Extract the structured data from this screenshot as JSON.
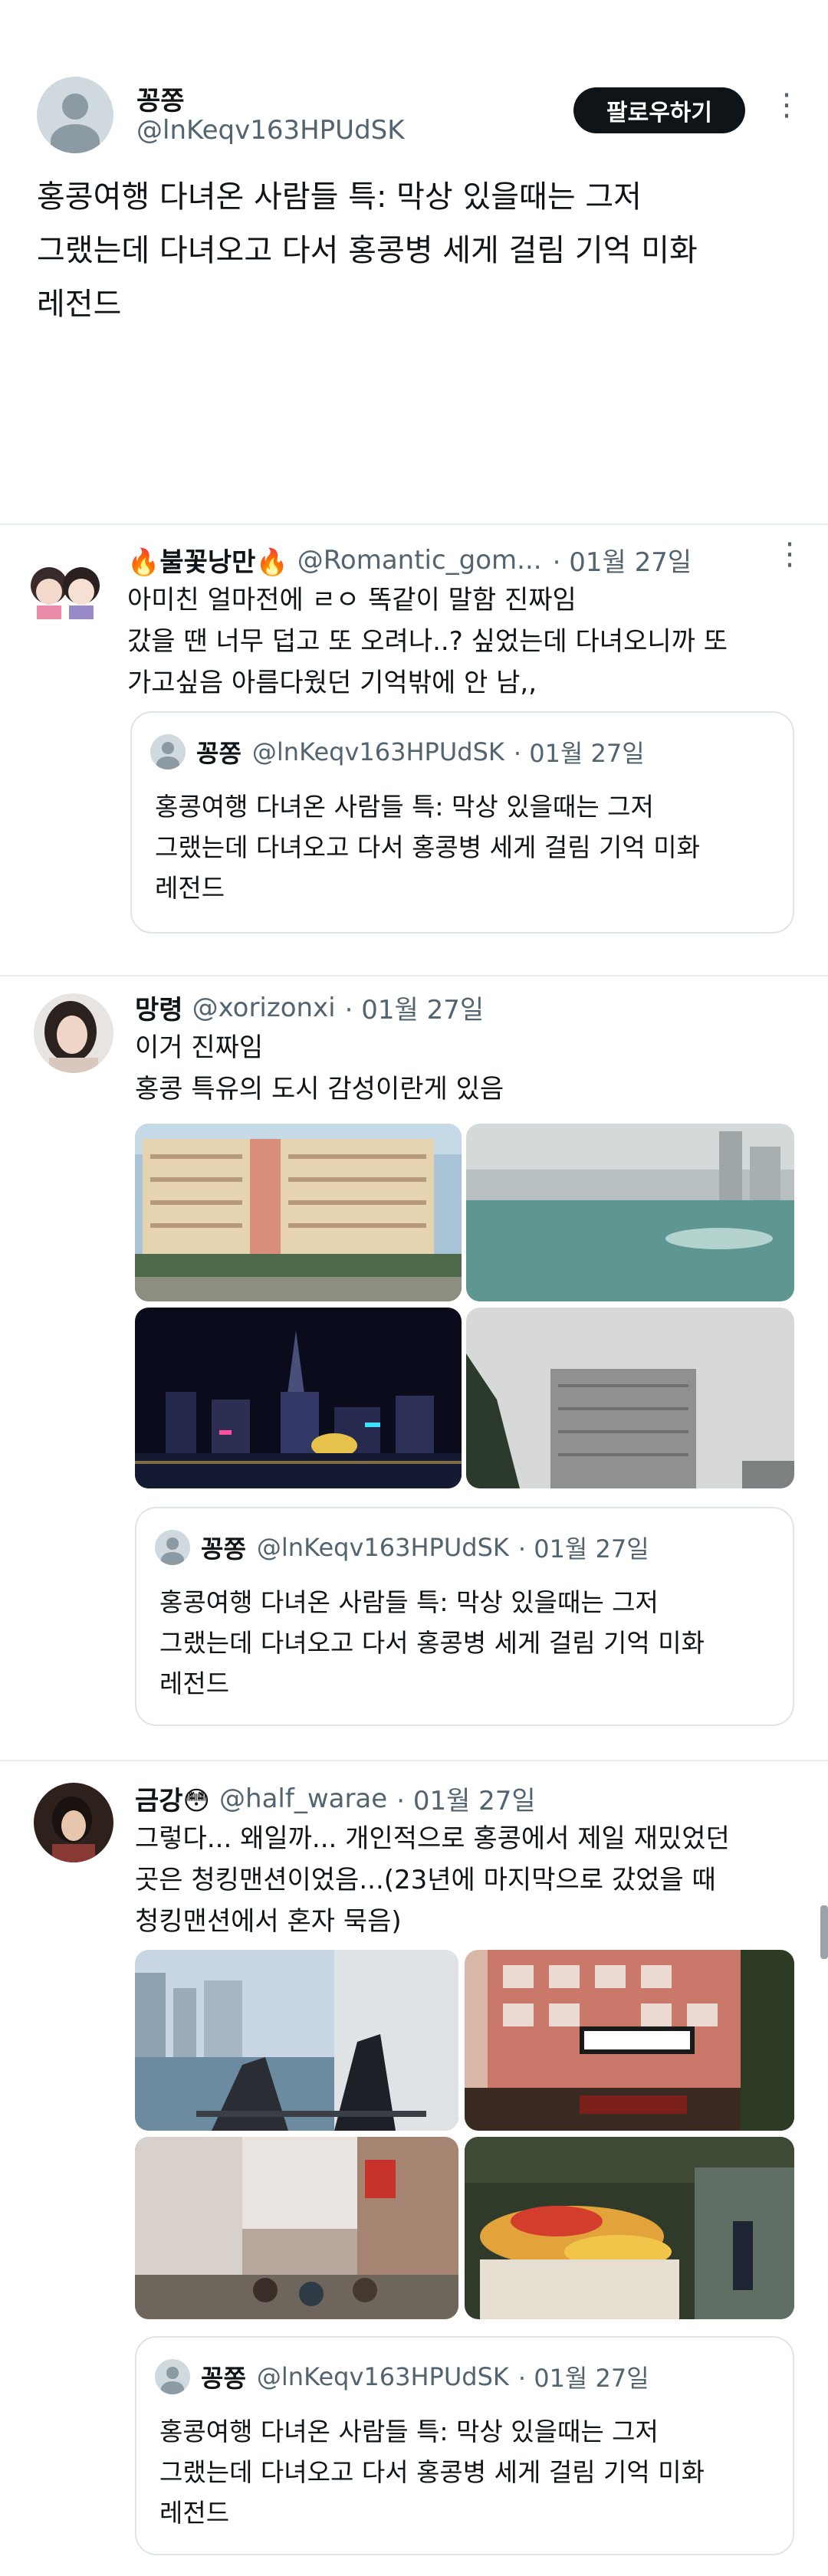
{
  "main_post": {
    "display_name": "꽁쫑",
    "handle": "@lnKeqv163HPUdSK",
    "follow_label": "팔로우하기",
    "text": "홍콩여행 다녀온 사람들 특: 막상 있을때는 그저\n그랬는데 다녀오고 다서 홍콩병 세게 걸림 기억 미화\n레전드"
  },
  "quoted_post": {
    "display_name": "꽁쫑",
    "handle": "@lnKeqv163HPUdSK",
    "date": "· 01월 27일",
    "text": "홍콩여행 다녀온 사람들 특: 막상 있을때는 그저\n그랬는데 다녀오고 다서 홍콩병 세게 걸림 기억 미화\n레전드"
  },
  "replies": [
    {
      "display_name": "🔥불꽃낭만🔥",
      "handle": "@Romantic_gom...",
      "date": "· 01월 27일",
      "text": "아미친 얼마전에 ㄹㅇ 똑같이 말함 진짜임\n갔을 땐 너무 덥고 또 오려나..? 싶었는데 다녀오니까 또\n가고싶음 아름다웠던 기억밖에 안 남,,"
    },
    {
      "display_name": "망령",
      "handle": "@xorizonxi",
      "date": "· 01월 27일",
      "text": "이거 진짜임\n홍콩 특유의 도시 감성이란게 있음"
    },
    {
      "display_name": "금강😳",
      "handle": "@half_warae",
      "date": "· 01월 27일",
      "text": "그렇다... 왜일까... 개인적으로 홍콩에서 제일 재밌었던\n곳은 청킹맨션이었음...(23년에 마지막으로 갔었을 때\n청킹맨션에서 혼자 묵음)"
    }
  ],
  "more_icon": "⋮",
  "colors": {
    "follow_bg": "#0f1419",
    "handle": "#536471",
    "border": "#dfe4e8"
  }
}
